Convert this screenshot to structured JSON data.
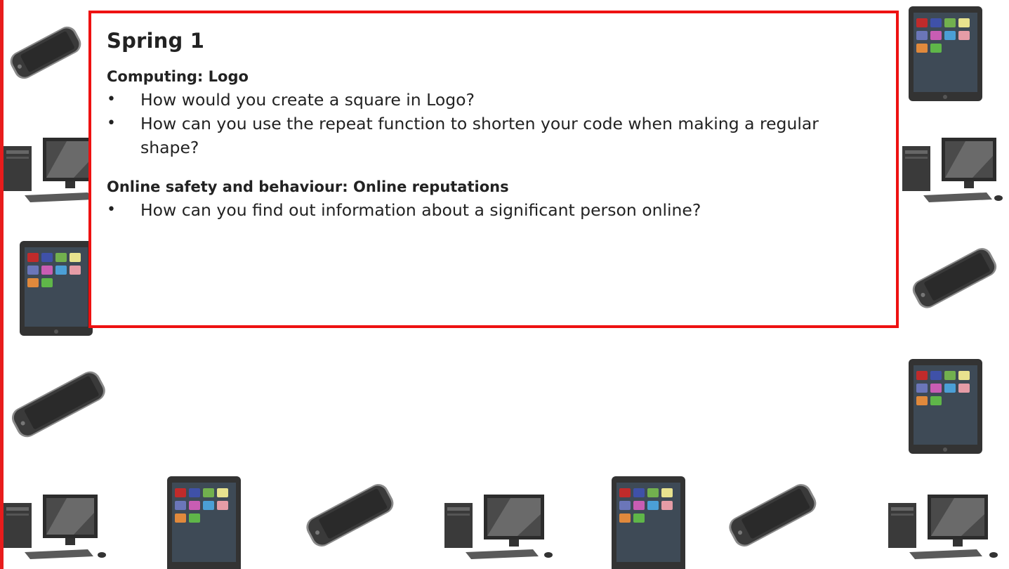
{
  "colors": {
    "border": "#ee1111",
    "text": "#222222"
  },
  "box": {
    "title": "Spring 1",
    "sections": [
      {
        "heading": "Computing: Logo",
        "items": [
          "How would you create a square in Logo?",
          "How can you use the repeat function to shorten your code when making a regular shape?"
        ]
      },
      {
        "heading": "Online safety and behaviour: Online reputations",
        "items": [
          "How can you find out information about a significant person online?"
        ]
      }
    ]
  },
  "decorations": [
    "phone-icon",
    "desktop-computer-icon",
    "tablet-icon"
  ]
}
